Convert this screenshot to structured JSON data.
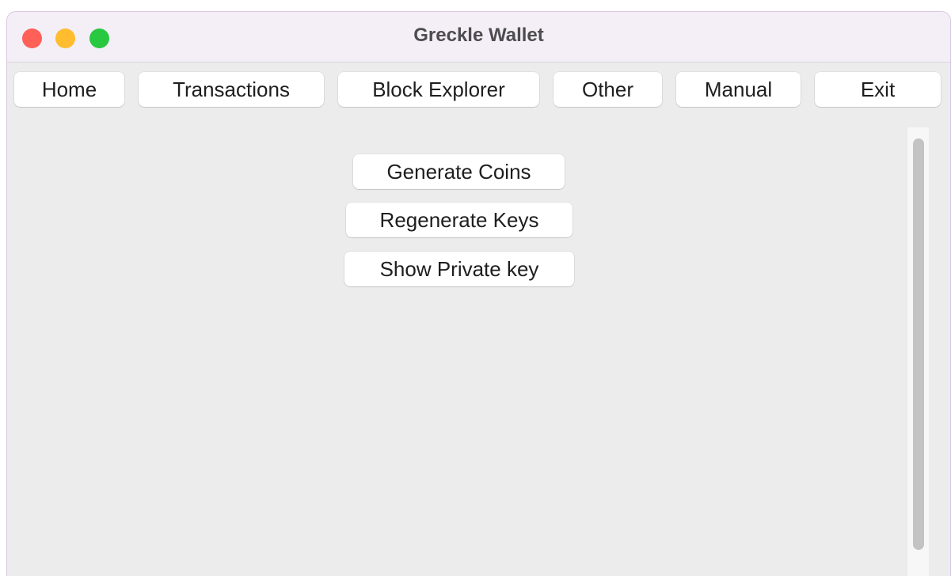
{
  "window": {
    "title": "Greckle Wallet"
  },
  "menu": {
    "items": [
      {
        "label": "Home"
      },
      {
        "label": "Transactions"
      },
      {
        "label": "Block Explorer"
      },
      {
        "label": "Other"
      },
      {
        "label": "Manual"
      },
      {
        "label": "Exit"
      }
    ]
  },
  "actions": {
    "generate_coins": "Generate Coins",
    "regenerate_keys": "Regenerate Keys",
    "show_private_key": "Show Private key"
  },
  "colors": {
    "close": "#fe5f57",
    "minimize": "#febc2e",
    "zoom": "#28c840",
    "background": "#ececec",
    "button": "#ffffff"
  }
}
